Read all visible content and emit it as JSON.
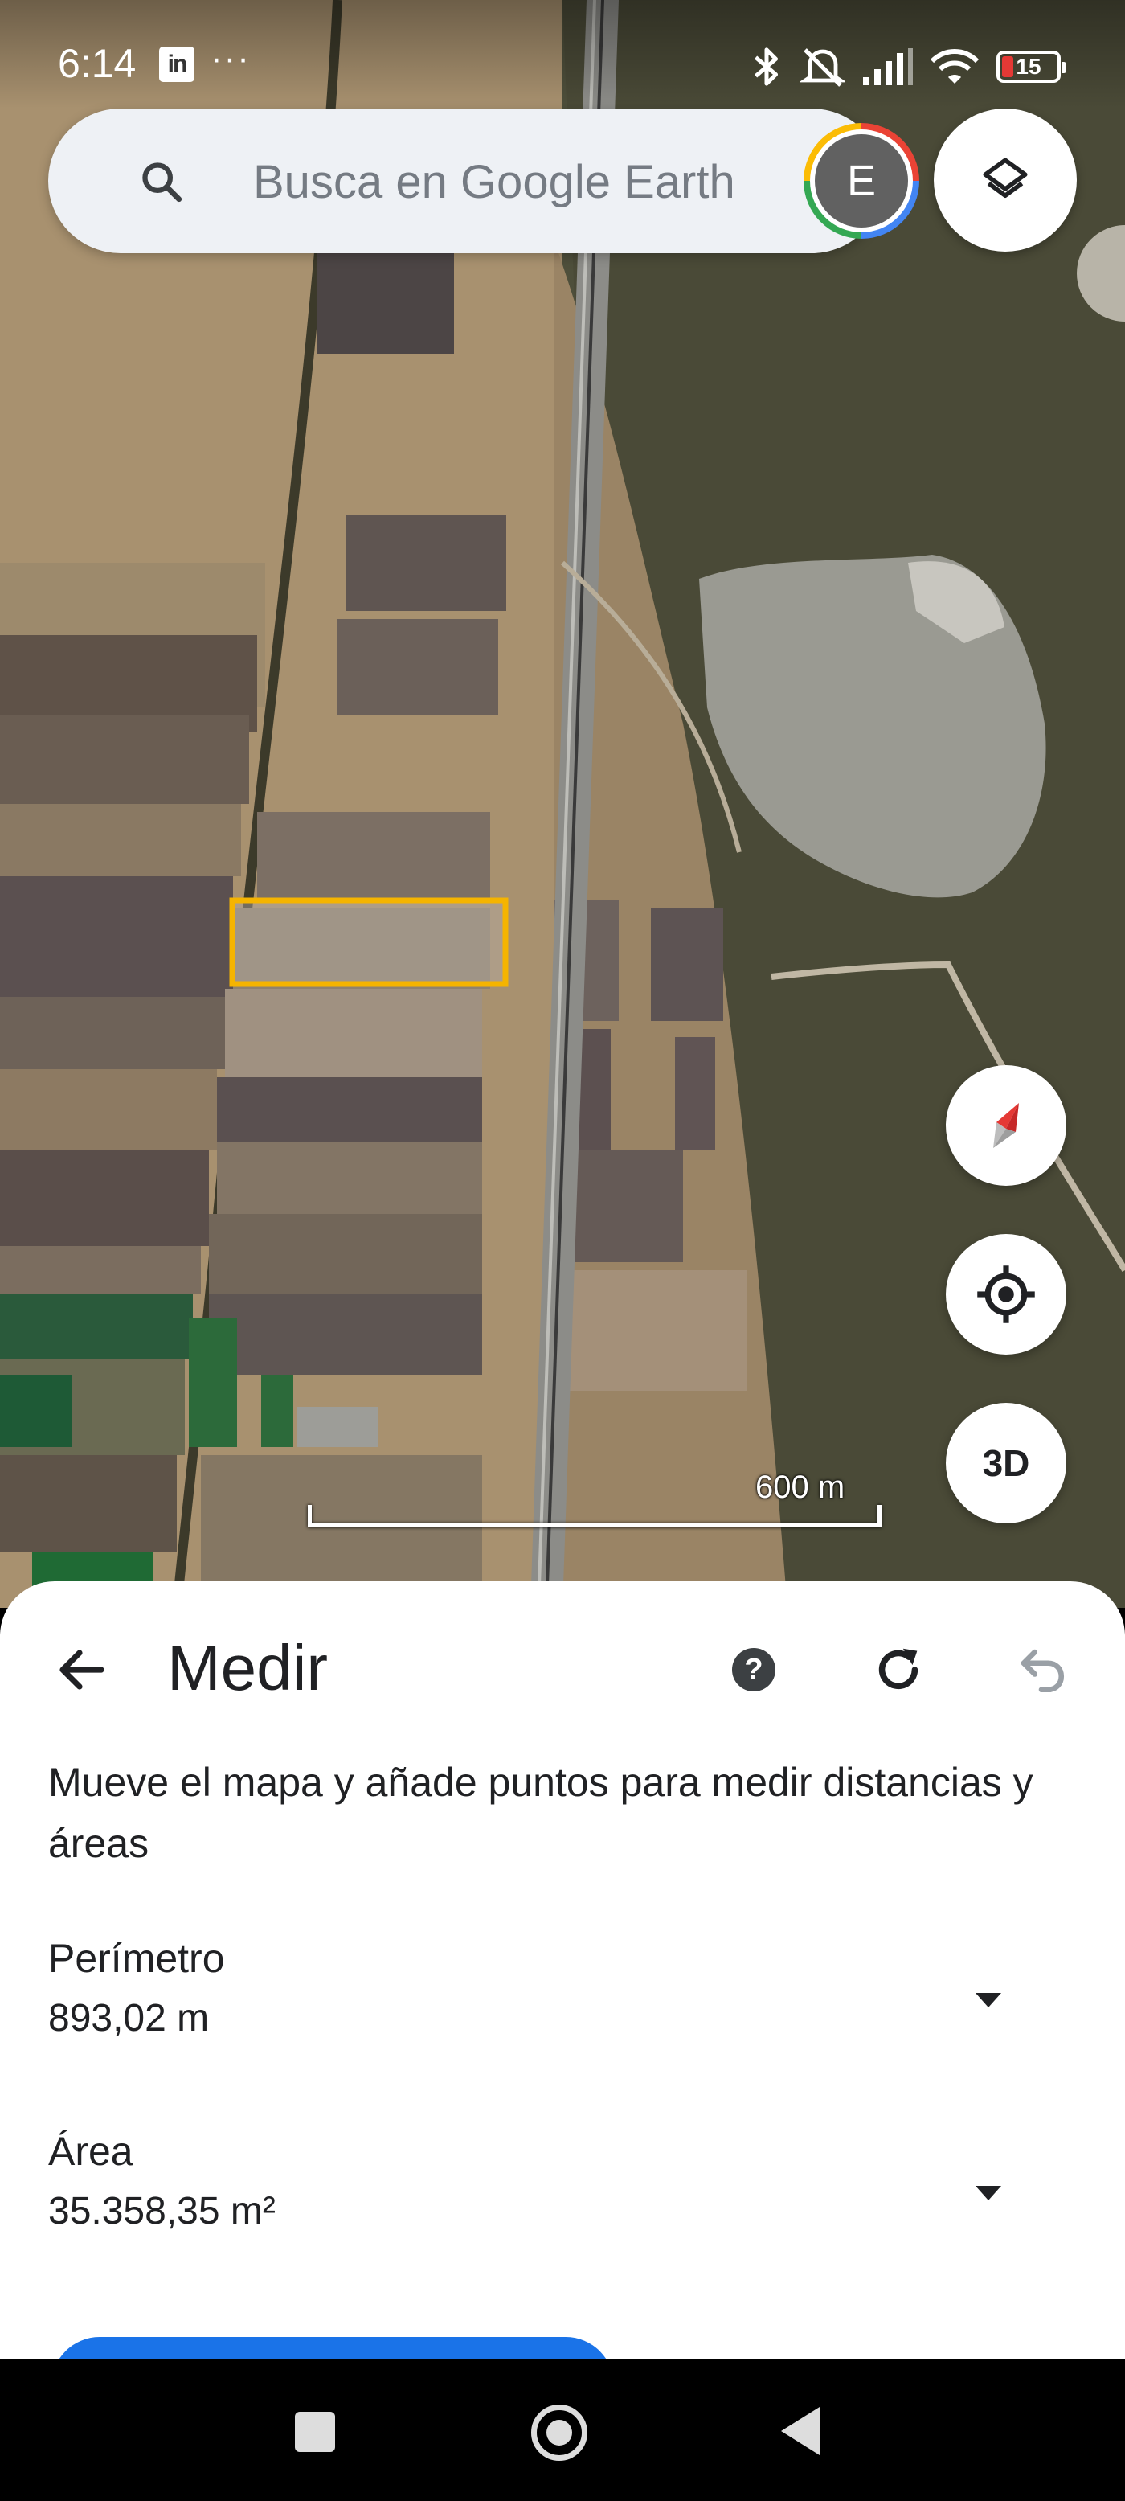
{
  "status_bar": {
    "time": "6:14",
    "linkedin_badge": "in",
    "more_indicator": "···",
    "battery_level": "15",
    "icons": [
      "bluetooth-icon",
      "mute-icon",
      "signal-icon",
      "wifi-icon",
      "battery-icon"
    ]
  },
  "search": {
    "placeholder": "Busca en Google Earth",
    "avatar_initial": "E"
  },
  "map": {
    "layers_icon": "layers-icon",
    "compass_icon": "compass-icon",
    "location_icon": "my-location-icon",
    "three_d_label": "3D",
    "scale_label": "600 m",
    "selection_color": "#f5b400"
  },
  "measure_sheet": {
    "title": "Medir",
    "description": "Mueve el mapa y añade puntos para medir distancias y áreas",
    "perimeter": {
      "label": "Perímetro",
      "value": "893,02 m"
    },
    "area": {
      "label": "Área",
      "value": "35.358,35 m²"
    },
    "accent_color": "#1a73e8"
  },
  "nav_bar": {
    "buttons": [
      "recents-button",
      "home-button",
      "back-button"
    ]
  }
}
